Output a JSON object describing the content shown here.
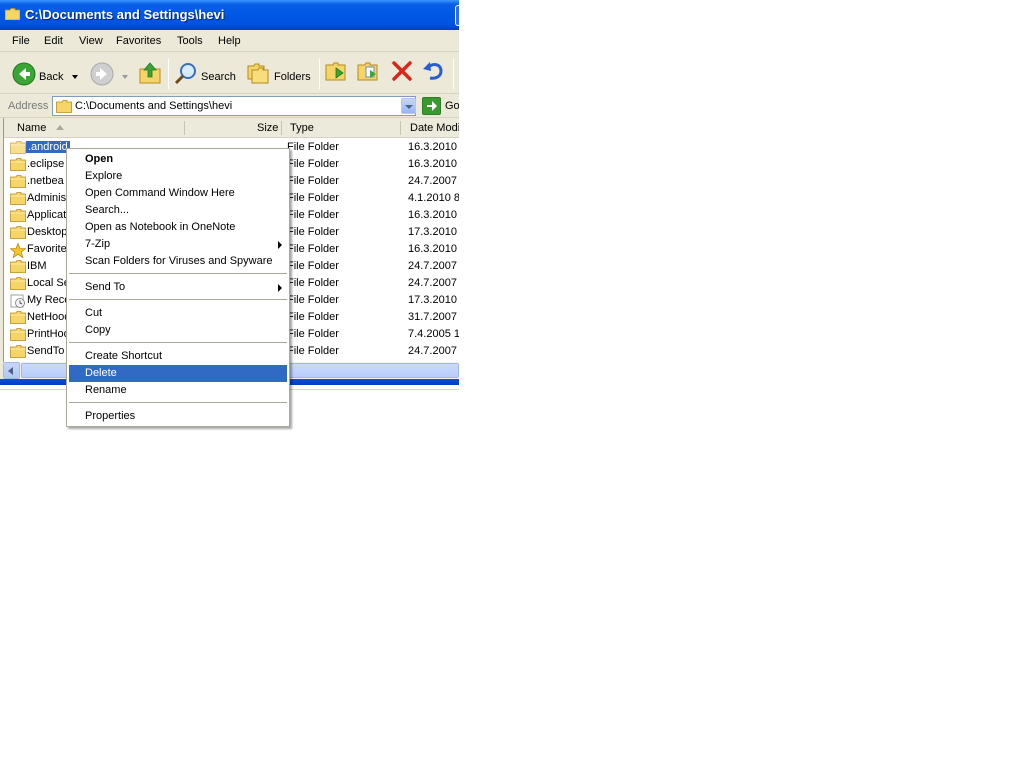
{
  "window": {
    "title": "C:\\Documents and Settings\\hevi"
  },
  "menubar": [
    "File",
    "Edit",
    "View",
    "Favorites",
    "Tools",
    "Help"
  ],
  "toolbar": {
    "back_label": "Back",
    "search_label": "Search",
    "folders_label": "Folders"
  },
  "address": {
    "label": "Address",
    "value": "C:\\Documents and Settings\\hevi",
    "go_label": "Go"
  },
  "columns": {
    "name": "Name",
    "size": "Size",
    "type": "Type",
    "date": "Date Modi"
  },
  "files": [
    {
      "name": ".android",
      "type": "File Folder",
      "date": "16.3.2010",
      "icon": "folder-icon",
      "selected": true
    },
    {
      "name": ".eclipse",
      "type": "File Folder",
      "date": "16.3.2010",
      "icon": "folder-icon"
    },
    {
      "name": ".netbea",
      "type": "File Folder",
      "date": "24.7.2007",
      "icon": "folder-icon"
    },
    {
      "name": "Administ",
      "type": "File Folder",
      "date": "4.1.2010 8",
      "icon": "folder-icon"
    },
    {
      "name": "Applicat",
      "type": "File Folder",
      "date": "16.3.2010",
      "icon": "folder-icon"
    },
    {
      "name": "Desktop",
      "type": "File Folder",
      "date": "17.3.2010",
      "icon": "folder-icon"
    },
    {
      "name": "Favorite",
      "type": "File Folder",
      "date": "16.3.2010",
      "icon": "star-icon"
    },
    {
      "name": "IBM",
      "type": "File Folder",
      "date": "24.7.2007",
      "icon": "folder-icon"
    },
    {
      "name": "Local Se",
      "type": "File Folder",
      "date": "24.7.2007",
      "icon": "folder-icon"
    },
    {
      "name": "My Rece",
      "type": "File Folder",
      "date": "17.3.2010",
      "icon": "recent-docs-icon"
    },
    {
      "name": "NetHood",
      "type": "File Folder",
      "date": "31.7.2007",
      "icon": "folder-icon"
    },
    {
      "name": "PrintHoo",
      "type": "File Folder",
      "date": "7.4.2005 1",
      "icon": "folder-icon"
    },
    {
      "name": "SendTo",
      "type": "File Folder",
      "date": "24.7.2007",
      "icon": "folder-icon"
    }
  ],
  "context_menu": {
    "items": [
      {
        "label": "Open",
        "bold": true
      },
      {
        "label": "Explore"
      },
      {
        "label": "Open Command Window Here"
      },
      {
        "label": "Search..."
      },
      {
        "label": "Open as Notebook in OneNote"
      },
      {
        "label": "7-Zip",
        "submenu": true
      },
      {
        "label": "Scan Folders for Viruses and Spyware"
      },
      {
        "label": "Send To",
        "submenu": true
      },
      {
        "label": "Cut"
      },
      {
        "label": "Copy"
      },
      {
        "label": "Create Shortcut"
      },
      {
        "label": "Delete",
        "highlighted": true
      },
      {
        "label": "Rename"
      },
      {
        "label": "Properties"
      }
    ]
  },
  "colors": {
    "selection": "#316ac5",
    "titlebar": "#0058e6",
    "window_bg": "#ece9d8"
  }
}
